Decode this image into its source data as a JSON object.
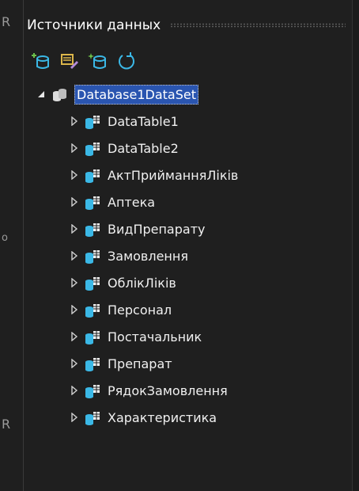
{
  "panel": {
    "title": "Источники данных"
  },
  "toolbar": {
    "buttons": [
      {
        "name": "add-data-source-button",
        "icon": "add-database-icon"
      },
      {
        "name": "edit-dataset-button",
        "icon": "edit-dataset-designer-icon"
      },
      {
        "name": "configure-dataset-button",
        "icon": "configure-dataset-wizard-icon"
      },
      {
        "name": "refresh-button",
        "icon": "refresh-icon"
      }
    ]
  },
  "tree": {
    "root": {
      "label": "Database1DataSet",
      "icon": "dataset-icon",
      "expanded": true
    },
    "tables": [
      {
        "label": "DataTable1"
      },
      {
        "label": "DataTable2"
      },
      {
        "label": "АктПрийманняЛіків"
      },
      {
        "label": "Аптека"
      },
      {
        "label": "ВидПрепарату"
      },
      {
        "label": "Замовлення"
      },
      {
        "label": "ОблікЛіків"
      },
      {
        "label": "Персонал"
      },
      {
        "label": "Постачальник"
      },
      {
        "label": "Препарат"
      },
      {
        "label": "РядокЗамовлення"
      },
      {
        "label": "Характеристика"
      }
    ]
  },
  "colors": {
    "background": "#1f1f1f",
    "accent_top": "#6a63d6",
    "selection": "#2a55b0",
    "icon_cyan": "#3bb8e6",
    "icon_green": "#6cc04a"
  }
}
